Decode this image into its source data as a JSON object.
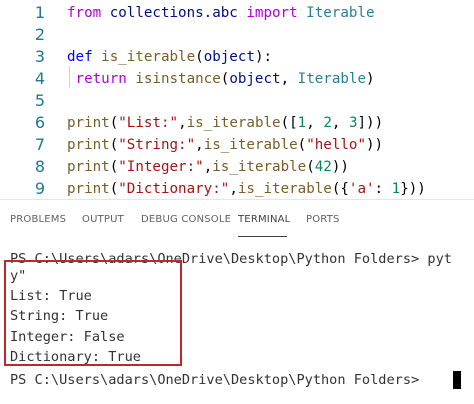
{
  "editor": {
    "lines": [
      {
        "n": "1",
        "tokens": [
          {
            "t": "from",
            "c": "kw"
          },
          {
            "t": " collections.abc ",
            "c": "var"
          },
          {
            "t": "import",
            "c": "kw"
          },
          {
            "t": " Iterable",
            "c": "cls"
          }
        ]
      },
      {
        "n": "2",
        "tokens": []
      },
      {
        "n": "3",
        "tokens": [
          {
            "t": "def",
            "c": "kwb"
          },
          {
            "t": " ",
            "c": ""
          },
          {
            "t": "is_iterable",
            "c": "fn"
          },
          {
            "t": "(",
            "c": ""
          },
          {
            "t": "object",
            "c": "var"
          },
          {
            "t": "):",
            "c": ""
          }
        ]
      },
      {
        "n": "4",
        "tokens": [
          {
            "t": " return",
            "c": "kw"
          },
          {
            "t": " ",
            "c": ""
          },
          {
            "t": "isinstance",
            "c": "fn"
          },
          {
            "t": "(",
            "c": ""
          },
          {
            "t": "object",
            "c": "var"
          },
          {
            "t": ", ",
            "c": ""
          },
          {
            "t": "Iterable",
            "c": "cls"
          },
          {
            "t": ")",
            "c": ""
          }
        ]
      },
      {
        "n": "5",
        "tokens": []
      },
      {
        "n": "6",
        "tokens": [
          {
            "t": "print",
            "c": "fn"
          },
          {
            "t": "(",
            "c": ""
          },
          {
            "t": "\"List:\"",
            "c": "str"
          },
          {
            "t": ",",
            "c": ""
          },
          {
            "t": "is_iterable",
            "c": "fn"
          },
          {
            "t": "([",
            "c": ""
          },
          {
            "t": "1",
            "c": "num"
          },
          {
            "t": ", ",
            "c": ""
          },
          {
            "t": "2",
            "c": "num"
          },
          {
            "t": ", ",
            "c": ""
          },
          {
            "t": "3",
            "c": "num"
          },
          {
            "t": "]))",
            "c": ""
          }
        ]
      },
      {
        "n": "7",
        "tokens": [
          {
            "t": "print",
            "c": "fn"
          },
          {
            "t": "(",
            "c": ""
          },
          {
            "t": "\"String:\"",
            "c": "str"
          },
          {
            "t": ",",
            "c": ""
          },
          {
            "t": "is_iterable",
            "c": "fn"
          },
          {
            "t": "(",
            "c": ""
          },
          {
            "t": "\"hello\"",
            "c": "str"
          },
          {
            "t": "))",
            "c": ""
          }
        ]
      },
      {
        "n": "8",
        "tokens": [
          {
            "t": "print",
            "c": "fn"
          },
          {
            "t": "(",
            "c": ""
          },
          {
            "t": "\"Integer:\"",
            "c": "str"
          },
          {
            "t": ",",
            "c": ""
          },
          {
            "t": "is_iterable",
            "c": "fn"
          },
          {
            "t": "(",
            "c": ""
          },
          {
            "t": "42",
            "c": "num"
          },
          {
            "t": "))",
            "c": ""
          }
        ]
      },
      {
        "n": "9",
        "tokens": [
          {
            "t": "print",
            "c": "fn"
          },
          {
            "t": "(",
            "c": ""
          },
          {
            "t": "\"Dictionary:\"",
            "c": "str"
          },
          {
            "t": ",",
            "c": ""
          },
          {
            "t": "is_iterable",
            "c": "fn"
          },
          {
            "t": "({",
            "c": ""
          },
          {
            "t": "'a'",
            "c": "str"
          },
          {
            "t": ": ",
            "c": ""
          },
          {
            "t": "1",
            "c": "num"
          },
          {
            "t": "}))",
            "c": ""
          }
        ]
      }
    ]
  },
  "panel": {
    "tabs": [
      "PROBLEMS",
      "OUTPUT",
      "DEBUG CONSOLE",
      "TERMINAL",
      "PORTS"
    ],
    "active_tab": "TERMINAL"
  },
  "terminal": {
    "prompt_line": "PS C:\\Users\\adars\\OneDrive\\Desktop\\Python Folders> pyt",
    "wrap_line": "y\"",
    "output": [
      "List: True",
      "String: True",
      "Integer: False",
      "Dictionary: True"
    ],
    "final_prompt": "PS C:\\Users\\adars\\OneDrive\\Desktop\\Python Folders> "
  },
  "colors": {
    "highlight_box": "#c0262d",
    "line_number": "#237893"
  }
}
